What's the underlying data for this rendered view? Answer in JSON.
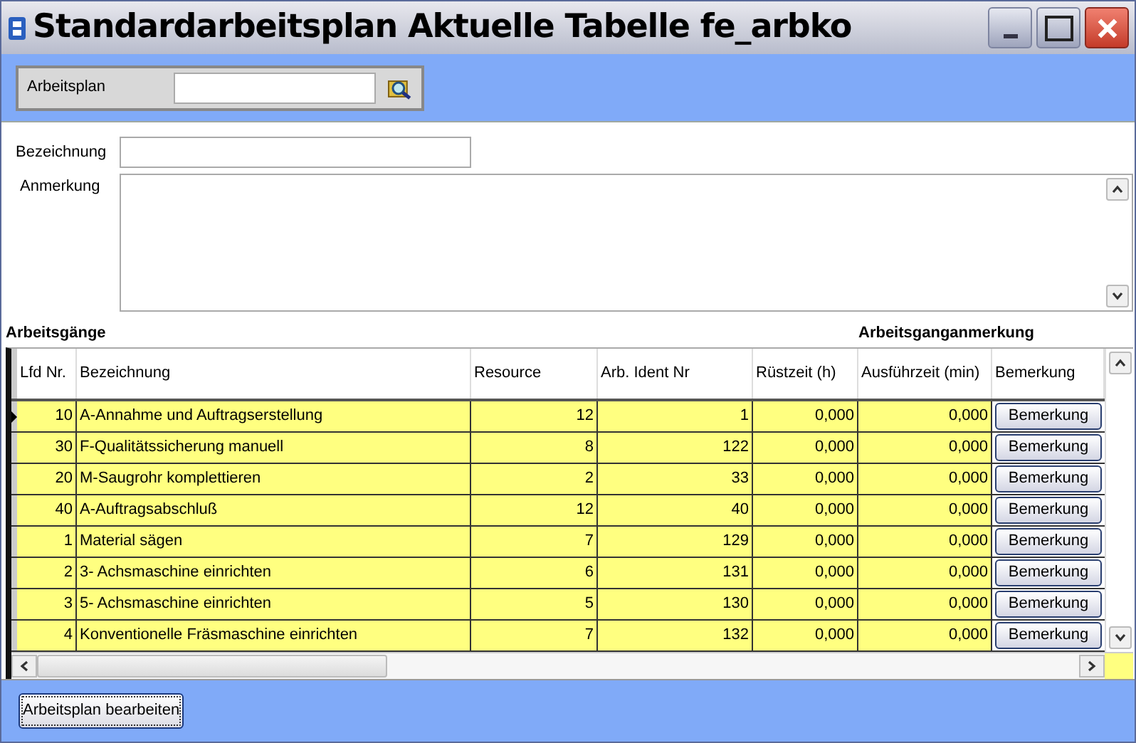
{
  "window": {
    "title": "Standardarbeitsplan Aktuelle Tabelle fe_arbko"
  },
  "search": {
    "label": "Arbeitsplan"
  },
  "form": {
    "bezeichnung_label": "Bezeichnung",
    "anmerkung_label": "Anmerkung"
  },
  "sections": {
    "left": "Arbeitsgänge",
    "right": "Arbeitsganganmerkung"
  },
  "table": {
    "columns": [
      "Lfd Nr.",
      "Bezeichnung",
      "Resource",
      "Arb. Ident Nr",
      "Rüstzeit (h)",
      "Ausführzeit (min)",
      "Bemerkung"
    ],
    "rows": [
      {
        "selected": true,
        "cells": [
          "10",
          "A-Annahme und Auftragserstellung",
          "12",
          "1",
          "0,000",
          "0,000"
        ],
        "button": "Bemerkung"
      },
      {
        "selected": false,
        "cells": [
          "30",
          "F-Qualitätssicherung manuell",
          "8",
          "122",
          "0,000",
          "0,000"
        ],
        "button": "Bemerkung"
      },
      {
        "selected": false,
        "cells": [
          "20",
          "M-Saugrohr komplettieren",
          "2",
          "33",
          "0,000",
          "0,000"
        ],
        "button": "Bemerkung"
      },
      {
        "selected": false,
        "cells": [
          "40",
          "A-Auftragsabschluß",
          "12",
          "40",
          "0,000",
          "0,000"
        ],
        "button": "Bemerkung"
      },
      {
        "selected": false,
        "cells": [
          "1",
          "Material sägen",
          "7",
          "129",
          "0,000",
          "0,000"
        ],
        "button": "Bemerkung"
      },
      {
        "selected": false,
        "cells": [
          "2",
          "3- Achsmaschine einrichten",
          "6",
          "131",
          "0,000",
          "0,000"
        ],
        "button": "Bemerkung"
      },
      {
        "selected": false,
        "cells": [
          "3",
          "5- Achsmaschine einrichten",
          "5",
          "130",
          "0,000",
          "0,000"
        ],
        "button": "Bemerkung"
      },
      {
        "selected": false,
        "cells": [
          "4",
          "Konventionelle Fräsmaschine einrichten",
          "7",
          "132",
          "0,000",
          "0,000"
        ],
        "button": "Bemerkung"
      }
    ]
  },
  "footer": {
    "button": "Arbeitsplan bearbeiten"
  }
}
